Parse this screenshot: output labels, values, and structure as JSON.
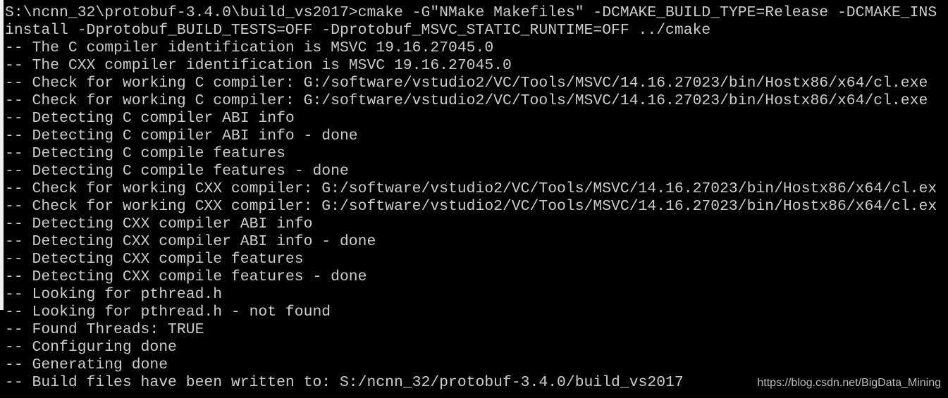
{
  "console": {
    "lines": [
      "S:\\ncnn_32\\protobuf-3.4.0\\build_vs2017>cmake -G\"NMake Makefiles\" -DCMAKE_BUILD_TYPE=Release -DCMAKE_INS",
      "install -Dprotobuf_BUILD_TESTS=OFF -Dprotobuf_MSVC_STATIC_RUNTIME=OFF ../cmake",
      "-- The C compiler identification is MSVC 19.16.27045.0",
      "-- The CXX compiler identification is MSVC 19.16.27045.0",
      "-- Check for working C compiler: G:/software/vstudio2/VC/Tools/MSVC/14.16.27023/bin/Hostx86/x64/cl.exe",
      "-- Check for working C compiler: G:/software/vstudio2/VC/Tools/MSVC/14.16.27023/bin/Hostx86/x64/cl.exe",
      "-- Detecting C compiler ABI info",
      "-- Detecting C compiler ABI info - done",
      "-- Detecting C compile features",
      "-- Detecting C compile features - done",
      "-- Check for working CXX compiler: G:/software/vstudio2/VC/Tools/MSVC/14.16.27023/bin/Hostx86/x64/cl.ex",
      "-- Check for working CXX compiler: G:/software/vstudio2/VC/Tools/MSVC/14.16.27023/bin/Hostx86/x64/cl.ex",
      "-- Detecting CXX compiler ABI info",
      "-- Detecting CXX compiler ABI info - done",
      "-- Detecting CXX compile features",
      "-- Detecting CXX compile features - done",
      "-- Looking for pthread.h",
      "-- Looking for pthread.h - not found",
      "-- Found Threads: TRUE",
      "-- Configuring done",
      "-- Generating done",
      "-- Build files have been written to: S:/ncnn_32/protobuf-3.4.0/build_vs2017"
    ]
  },
  "watermark": "https://blog.csdn.net/BigData_Mining"
}
